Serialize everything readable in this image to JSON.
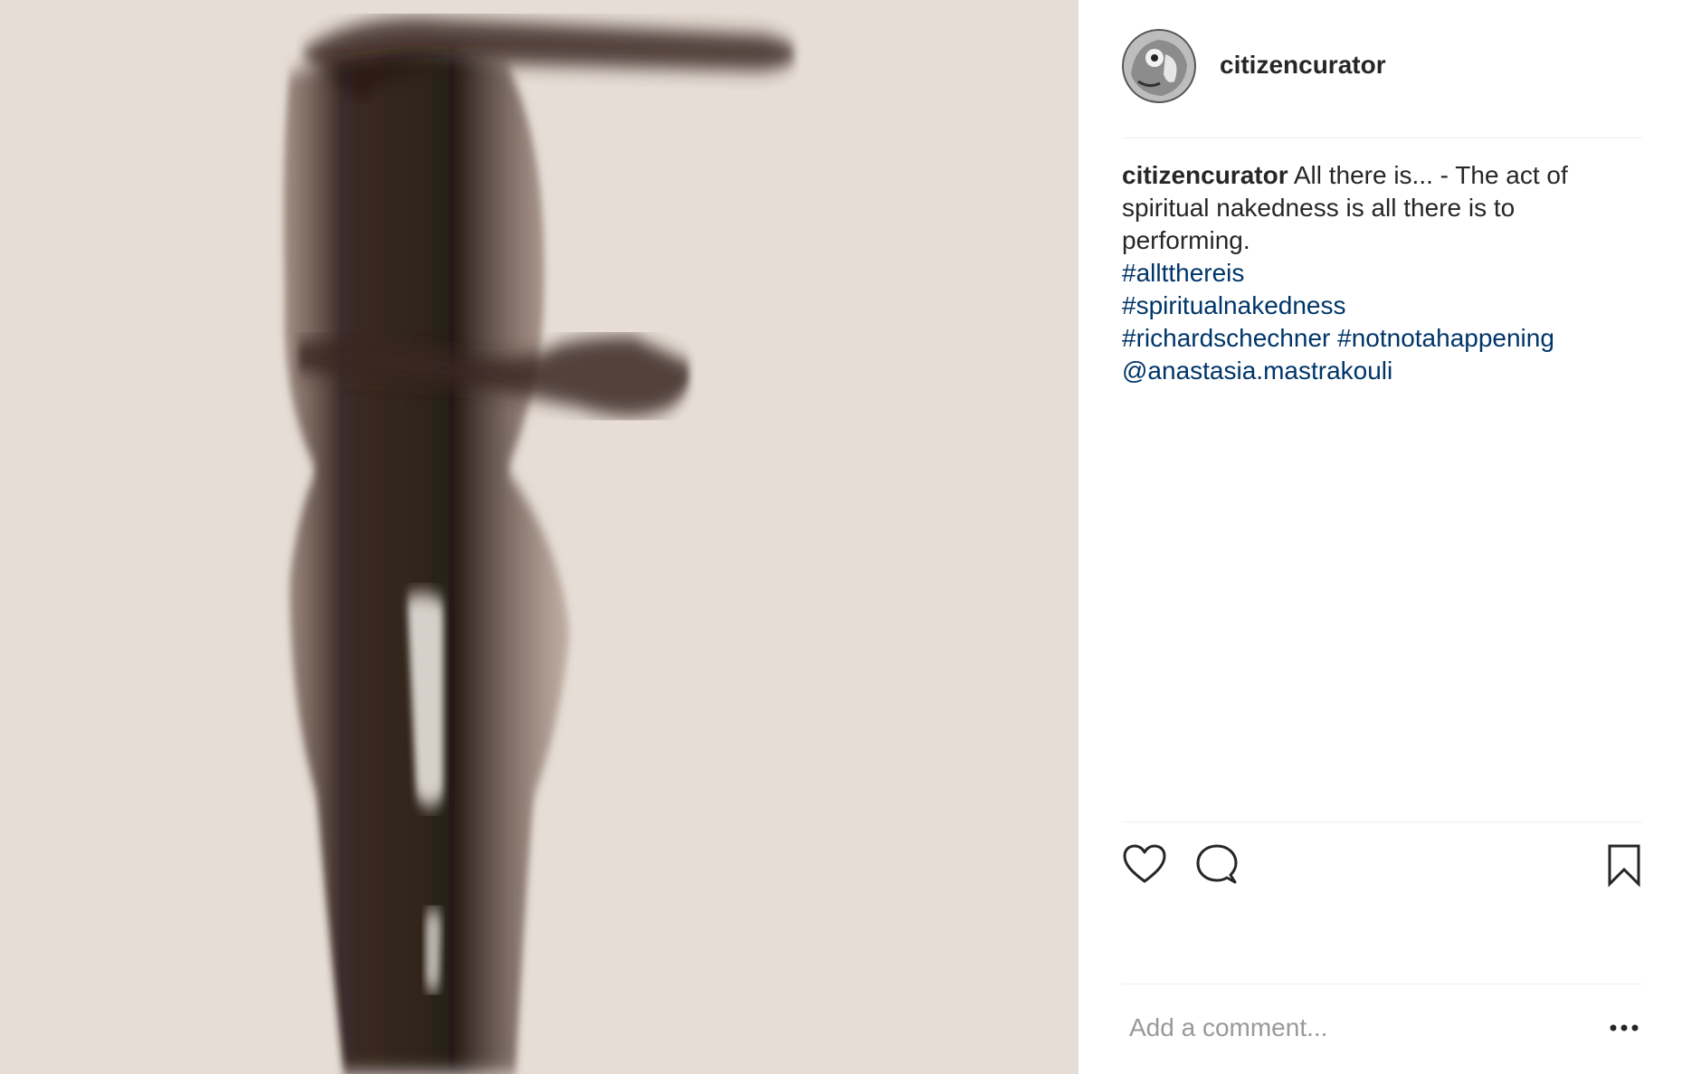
{
  "post": {
    "username": "citizencurator",
    "caption": {
      "username": "citizencurator",
      "text": "All there is... - The act of spiritual nakedness is all there is to performing.",
      "hashtags": [
        "#alltthereis",
        "#spiritualnakedness",
        "#richardschechner",
        "#notnotahappening"
      ],
      "mention": "@anastasia.mastrakouli"
    },
    "comment": {
      "placeholder": "Add a comment..."
    },
    "icons": {
      "like": "heart-icon",
      "comment": "speech-bubble-icon",
      "save": "bookmark-icon",
      "more": "more-options-icon"
    },
    "colors": {
      "link": "#003569",
      "photo_background": "#e6ded6",
      "figure": "#2a1a14"
    }
  }
}
